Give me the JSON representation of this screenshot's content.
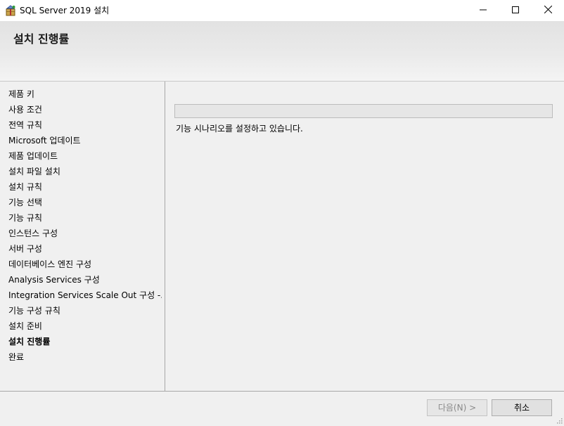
{
  "window": {
    "title": "SQL Server 2019 설치",
    "icon": "installer-box-icon",
    "controls": [
      "minimize-icon",
      "maximize-icon",
      "close-icon"
    ]
  },
  "header": {
    "title": "설치 진행률"
  },
  "nav": {
    "items": [
      {
        "label": "제품 키",
        "active": false
      },
      {
        "label": "사용 조건",
        "active": false
      },
      {
        "label": "전역 규칙",
        "active": false
      },
      {
        "label": "Microsoft 업데이트",
        "active": false
      },
      {
        "label": "제품 업데이트",
        "active": false
      },
      {
        "label": "설치 파일 설치",
        "active": false
      },
      {
        "label": "설치 규칙",
        "active": false
      },
      {
        "label": "기능 선택",
        "active": false
      },
      {
        "label": "기능 규칙",
        "active": false
      },
      {
        "label": "인스턴스 구성",
        "active": false
      },
      {
        "label": "서버 구성",
        "active": false
      },
      {
        "label": "데이터베이스 엔진 구성",
        "active": false
      },
      {
        "label": "Analysis Services 구성",
        "active": false
      },
      {
        "label": "Integration Services Scale Out 구성 -...",
        "active": false
      },
      {
        "label": "기능 구성 규칙",
        "active": false
      },
      {
        "label": "설치 준비",
        "active": false
      },
      {
        "label": "설치 진행률",
        "active": true
      },
      {
        "label": "완료",
        "active": false
      }
    ]
  },
  "main": {
    "progress": 0,
    "status": "기능 시나리오를 설정하고 있습니다."
  },
  "footer": {
    "next_label": "다음(N) >",
    "next_enabled": false,
    "cancel_label": "취소"
  }
}
